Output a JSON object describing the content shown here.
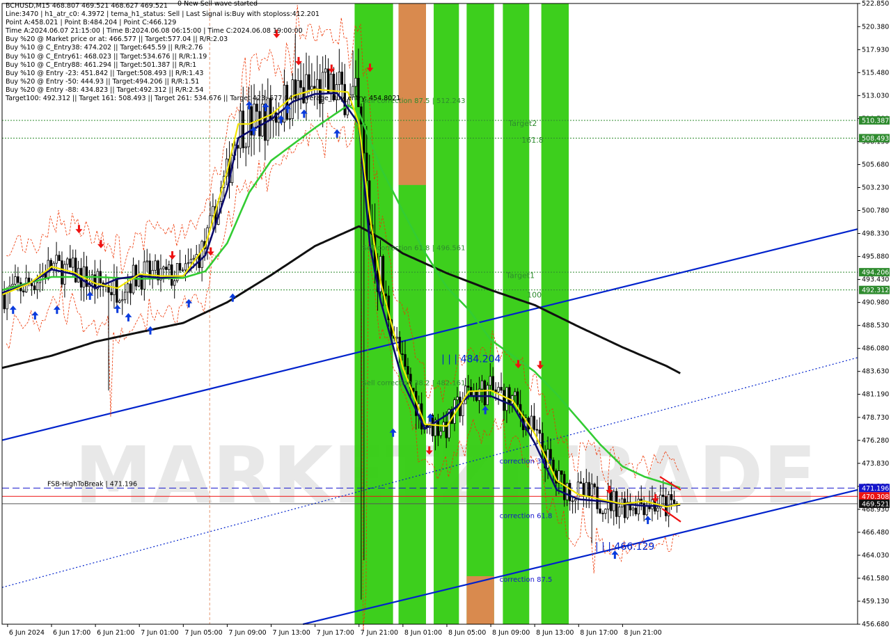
{
  "info_lines": [
    "BCHUSD,M15  468.807 469.521 468.627 469.521",
    "Line:3470 | h1_atr_c0: 4.3972 | tema_h1_status: Sell | Last Signal is:Buy with stoploss:412.201",
    "Point A:458.021 | Point B:484.204 | Point C:466.129",
    "Time A:2024.06.07 21:15:00 | Time B:2024.06.08 06:15:00 | Time C:2024.06.08 19:00:00",
    "Buy %20 @ Market price or at: 466.577 || Target:577.04 || R/R:2.03",
    "Buy %10 @ C_Entry38: 474.202 || Target:645.59 || R/R:2.76",
    "Buy %10 @ C_Entry61: 468.023 || Target:534.676 || R/R:1.19",
    "Buy %10 @ C_Entry88: 461.294 || Target:501.387 || R/R:1",
    "Buy %10 @ Entry -23: 451.842 || Target:508.493 || R/R:1.43",
    "Buy %20 @ Entry -50: 444.93 || Target:494.206 || R/R:1.51",
    "Buy %20 @ Entry -88: 434.823 || Target:492.312 || R/R:2.54",
    "Target100: 492.312 || Target 161: 508.493 || Target 261: 534.676 || Target 423: 577.04 || average_Buy_entry: 454.8021"
  ],
  "wave_status": "0 New Sell wave started",
  "watermark": "MARKETZITRADE",
  "colors": {
    "background": "#ffffff",
    "green_band": "#33cc11",
    "orange_band": "#d98a4e",
    "black_ma": "#111111",
    "green_ma": "#33cc33",
    "navy_ma": "#0a0a6e",
    "yellow_ma": "#f2e600",
    "channel": "#0022cc",
    "level_label_green": "#2e8b2e",
    "level_label_blue": "#1515cc",
    "level_label_red": "#ee1111",
    "price_label_black": "#111111",
    "candle": "#000000",
    "envelope": "#ee3300",
    "buy_arrow": "#0a3bdd",
    "sell_arrow": "#ee1111"
  },
  "chart_data": {
    "type": "candlestick",
    "symbol": "BCHUSD",
    "timeframe": "M15",
    "ylim": [
      456.68,
      522.85
    ],
    "y_ticks": [
      "522.850",
      "520.380",
      "517.930",
      "515.480",
      "513.030",
      "510.580",
      "508.130",
      "505.680",
      "503.230",
      "500.780",
      "498.330",
      "495.880",
      "493.430",
      "490.980",
      "488.530",
      "486.080",
      "483.630",
      "481.190",
      "478.730",
      "476.280",
      "473.830",
      "471.380",
      "468.930",
      "466.480",
      "464.030",
      "461.580",
      "459.130",
      "456.680"
    ],
    "x_ticks": [
      "6 Jun 2024",
      "6 Jun 17:00",
      "6 Jun 21:00",
      "7 Jun 01:00",
      "7 Jun 05:00",
      "7 Jun 09:00",
      "7 Jun 13:00",
      "7 Jun 17:00",
      "7 Jun 21:00",
      "8 Jun 01:00",
      "8 Jun 05:00",
      "8 Jun 09:00",
      "8 Jun 13:00",
      "8 Jun 17:00",
      "8 Jun 21:00"
    ],
    "x_tick_hours": [
      0,
      4,
      8,
      12,
      16,
      20,
      24,
      28,
      32,
      36,
      40,
      44,
      48,
      52,
      56
    ],
    "x_hours_range": [
      -0.5,
      77.4
    ],
    "price_levels": [
      {
        "label": "510.387",
        "price": 510.387,
        "style": "dotted",
        "color": "green"
      },
      {
        "label": "508.493",
        "price": 508.493,
        "style": "dotted",
        "color": "green"
      },
      {
        "label": "494.206",
        "price": 494.206,
        "style": "dotted",
        "color": "green"
      },
      {
        "label": "492.312",
        "price": 492.312,
        "style": "dotted",
        "color": "green"
      },
      {
        "label": "471.196",
        "price": 471.196,
        "style": "dashed",
        "color": "blue"
      },
      {
        "label": "470.308",
        "price": 470.308,
        "style": "solid",
        "color": "red"
      },
      {
        "label": "469.521",
        "price": 469.521,
        "style": "solid",
        "color": "black"
      }
    ],
    "fsb_label": "FSB-HighToBreak | 471.196",
    "annotations": [
      {
        "text": "Sell correction 87.5 | 512.243",
        "t": 32.3,
        "price": 512.243,
        "color": "#2e8b2e",
        "size": 10
      },
      {
        "text": "Target2",
        "t": 45.6,
        "price": 509.8,
        "color": "#2e8b2e",
        "size": 11
      },
      {
        "text": "161.8",
        "t": 46.8,
        "price": 508.0,
        "color": "#2e8b2e",
        "size": 11
      },
      {
        "text": "Sell correction 61.8 | 496.561",
        "t": 32.3,
        "price": 496.561,
        "color": "#2e8b2e",
        "size": 10
      },
      {
        "text": "Target1",
        "t": 45.4,
        "price": 493.6,
        "color": "#2e8b2e",
        "size": 11
      },
      {
        "text": "100",
        "t": 47.3,
        "price": 491.5,
        "color": "#2e8b2e",
        "size": 11
      },
      {
        "text": "| | | 484.204",
        "t": 39.5,
        "price": 484.6,
        "color": "#0022cc",
        "size": 14
      },
      {
        "text": "Sell correction 38.2 | 482.161",
        "t": 32.3,
        "price": 482.161,
        "color": "#2e8b2e",
        "size": 10
      },
      {
        "text": "correction 38.2",
        "t": 44.8,
        "price": 473.8,
        "color": "#1515cc",
        "size": 10
      },
      {
        "text": "correction 61.8",
        "t": 44.8,
        "price": 468.0,
        "color": "#1515cc",
        "size": 10
      },
      {
        "text": "| | | 466.129",
        "t": 53.5,
        "price": 464.6,
        "color": "#0022cc",
        "size": 14
      },
      {
        "text": "correction 87.5",
        "t": 44.8,
        "price": 461.2,
        "color": "#1515cc",
        "size": 10
      }
    ],
    "bands": [
      {
        "t0": 31.6,
        "t1": 35.1,
        "color": "green"
      },
      {
        "t0": 35.6,
        "t1": 38.1,
        "color": "green"
      },
      {
        "t0": 38.8,
        "t1": 41.1,
        "color": "green"
      },
      {
        "t0": 41.8,
        "t1": 44.3,
        "color": "green"
      },
      {
        "t0": 45.1,
        "t1": 47.5,
        "color": "green"
      },
      {
        "t0": 48.6,
        "t1": 51.1,
        "color": "green"
      }
    ],
    "ma_black": {
      "times": [
        -0.5,
        4,
        8,
        12,
        16,
        20,
        24,
        28,
        32,
        34,
        36,
        40,
        44,
        48,
        52,
        56,
        60,
        61.3
      ],
      "values": [
        484.0,
        485.3,
        486.8,
        487.8,
        488.8,
        491.0,
        493.9,
        497.0,
        499.1,
        497.8,
        496.2,
        494.1,
        492.3,
        490.7,
        488.4,
        486.2,
        484.2,
        483.4
      ]
    },
    "ma_green": {
      "times": [
        -0.5,
        4,
        8,
        12,
        16,
        18,
        20,
        22,
        24,
        28,
        31,
        32,
        34,
        36,
        38,
        40,
        42,
        44,
        46,
        48,
        50,
        52,
        54,
        56,
        58,
        61.3
      ],
      "values": [
        492.3,
        493.7,
        493.7,
        493.5,
        493.6,
        494.3,
        497.3,
        502.7,
        506.1,
        509.6,
        512.0,
        511.2,
        505.3,
        500.7,
        496.3,
        492.6,
        490.2,
        487.0,
        485.3,
        483.6,
        481.2,
        478.5,
        475.8,
        473.5,
        472.4,
        471.2
      ]
    },
    "ma_navy": {
      "times": [
        -0.5,
        2,
        4,
        6,
        8,
        10,
        12,
        14,
        16,
        18,
        20,
        21,
        22,
        24,
        26,
        28,
        30,
        32,
        33,
        34,
        36,
        38,
        40,
        42,
        44,
        46,
        48,
        50,
        52,
        54,
        56,
        58,
        60,
        61.3
      ],
      "values": [
        492.0,
        493.0,
        494.5,
        494.0,
        492.5,
        493.5,
        493.8,
        493.6,
        493.8,
        496.0,
        503.0,
        508.5,
        509.2,
        510.5,
        512.4,
        513.2,
        513.3,
        510.0,
        497.0,
        491.0,
        482.5,
        477.5,
        479.0,
        481.0,
        481.0,
        480.0,
        476.0,
        471.0,
        470.0,
        469.8,
        469.5,
        469.3,
        469.3,
        469.4
      ]
    },
    "ma_yellow": {
      "times": [
        -0.5,
        2,
        4,
        6,
        8,
        10,
        12,
        14,
        16,
        18,
        20,
        21,
        22,
        24,
        26,
        28,
        30,
        31,
        32,
        33,
        34,
        36,
        38,
        40,
        42,
        44,
        46,
        48,
        50,
        52,
        54,
        56,
        58,
        60,
        61.3
      ],
      "values": [
        491.8,
        493.0,
        494.8,
        494.2,
        493.0,
        492.5,
        494.0,
        493.8,
        493.8,
        497.0,
        505.0,
        510.0,
        510.0,
        511.0,
        513.0,
        513.7,
        513.5,
        513.4,
        510.0,
        500.0,
        493.0,
        484.0,
        478.0,
        477.8,
        481.5,
        481.6,
        480.5,
        477.0,
        472.0,
        470.5,
        470.0,
        469.5,
        469.8,
        469.2,
        469.5
      ]
    },
    "channel_lower": {
      "p1": {
        "t": 26.9,
        "price": 456.68
      },
      "p2": {
        "t": 77.4,
        "price": 471.0
      }
    },
    "channel_upper": {
      "p1": {
        "t": -0.5,
        "price": 476.3
      },
      "p2": {
        "t": 77.4,
        "price": 498.8
      }
    },
    "channel_dotted": {
      "p1": {
        "t": -0.5,
        "price": 460.6
      },
      "p2": {
        "t": 77.4,
        "price": 485.1
      }
    },
    "buy_arrows_t": [
      0.5,
      2.5,
      4.5,
      7.5,
      11.0,
      13.0,
      16.5,
      20.5,
      22.0,
      23.5,
      25.5,
      30.0,
      38.5,
      43.5,
      55.3,
      58.3,
      22.4,
      24.9,
      10.0,
      35.1,
      27.0
    ],
    "buy_arrows_price": [
      490.2,
      489.6,
      490.2,
      491.7,
      489.4,
      488.0,
      490.9,
      491.5,
      512.0,
      511.8,
      511.6,
      509.0,
      478.7,
      479.5,
      464.1,
      467.8,
      509.3,
      510.5,
      490.3,
      477.1,
      511.1
    ],
    "sell_arrows_t": [
      6.5,
      8.5,
      15.0,
      18.5,
      24.5,
      26.5,
      29.5,
      33.0,
      38.4,
      46.5,
      48.5,
      54.8,
      59.0
    ],
    "sell_arrows_price": [
      498.8,
      497.2,
      496.0,
      496.4,
      519.6,
      516.7,
      515.9,
      516.0,
      475.2,
      484.4,
      484.3,
      471.0,
      470.1
    ]
  }
}
